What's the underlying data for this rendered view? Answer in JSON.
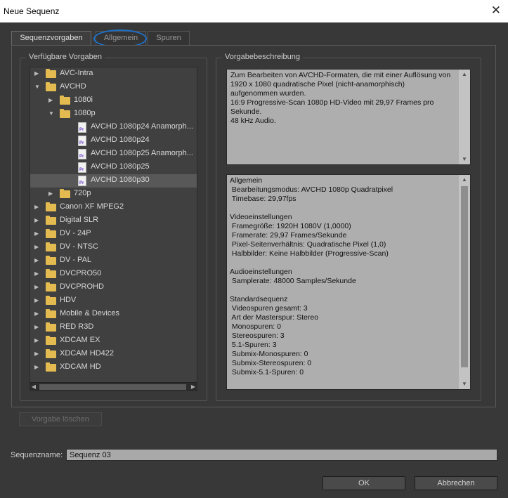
{
  "window": {
    "title": "Neue Sequenz",
    "close_glyph": "✕"
  },
  "tabs": [
    "Sequenzvorgaben",
    "Allgemein",
    "Spuren"
  ],
  "presets_group": {
    "label": "Verfügbare Vorgaben"
  },
  "tree": [
    {
      "label": "AVC-Intra",
      "type": "folder",
      "level": 0,
      "expanded": false
    },
    {
      "label": "AVCHD",
      "type": "folder",
      "level": 0,
      "expanded": true
    },
    {
      "label": "1080i",
      "type": "folder",
      "level": 1,
      "expanded": false
    },
    {
      "label": "1080p",
      "type": "folder",
      "level": 1,
      "expanded": true
    },
    {
      "label": "AVCHD 1080p24 Anamorph...",
      "type": "file",
      "level": 2
    },
    {
      "label": "AVCHD 1080p24",
      "type": "file",
      "level": 2
    },
    {
      "label": "AVCHD 1080p25 Anamorph...",
      "type": "file",
      "level": 2
    },
    {
      "label": "AVCHD 1080p25",
      "type": "file",
      "level": 2
    },
    {
      "label": "AVCHD 1080p30",
      "type": "file",
      "level": 2,
      "selected": true
    },
    {
      "label": "720p",
      "type": "folder",
      "level": 1,
      "expanded": false
    },
    {
      "label": "Canon XF MPEG2",
      "type": "folder",
      "level": 0,
      "expanded": false
    },
    {
      "label": "Digital SLR",
      "type": "folder",
      "level": 0,
      "expanded": false
    },
    {
      "label": "DV - 24P",
      "type": "folder",
      "level": 0,
      "expanded": false
    },
    {
      "label": "DV - NTSC",
      "type": "folder",
      "level": 0,
      "expanded": false
    },
    {
      "label": "DV - PAL",
      "type": "folder",
      "level": 0,
      "expanded": false
    },
    {
      "label": "DVCPRO50",
      "type": "folder",
      "level": 0,
      "expanded": false
    },
    {
      "label": "DVCPROHD",
      "type": "folder",
      "level": 0,
      "expanded": false
    },
    {
      "label": "HDV",
      "type": "folder",
      "level": 0,
      "expanded": false
    },
    {
      "label": "Mobile & Devices",
      "type": "folder",
      "level": 0,
      "expanded": false
    },
    {
      "label": "RED R3D",
      "type": "folder",
      "level": 0,
      "expanded": false
    },
    {
      "label": "XDCAM EX",
      "type": "folder",
      "level": 0,
      "expanded": false
    },
    {
      "label": "XDCAM HD422",
      "type": "folder",
      "level": 0,
      "expanded": false
    },
    {
      "label": "XDCAM HD",
      "type": "folder",
      "level": 0,
      "expanded": false
    }
  ],
  "description_group": {
    "label": "Vorgabebeschreibung"
  },
  "description_text": [
    "Zum Bearbeiten von AVCHD-Formaten, die mit einer Auflösung von",
    "1920 x 1080 quadratische Pixel (nicht-anamorphisch)",
    "aufgenommen wurden.",
    "16:9 Progressive-Scan 1080p HD-Video mit 29,97 Frames pro",
    "Sekunde.",
    "48 kHz Audio."
  ],
  "details_text": [
    "Allgemein",
    " Bearbeitungsmodus: AVCHD 1080p Quadratpixel",
    " Timebase: 29,97fps",
    "",
    "Videoeinstellungen",
    " Framegröße: 1920H 1080V (1,0000)",
    " Framerate: 29,97 Frames/Sekunde",
    " Pixel-Seitenverhältnis: Quadratische Pixel (1,0)",
    " Halbbilder: Keine Halbbilder (Progressive-Scan)",
    "",
    "Audioeinstellungen",
    " Samplerate: 48000 Samples/Sekunde",
    "",
    "Standardsequenz",
    " Videospuren gesamt: 3",
    " Art der Masterspur: Stereo",
    " Monospuren: 0",
    " Stereospuren: 3",
    " 5.1-Spuren: 3",
    " Submix-Monospuren: 0",
    " Submix-Stereospuren: 0",
    " Submix-5.1-Spuren: 0"
  ],
  "buttons": {
    "delete_preset": "Vorgabe löschen",
    "ok": "OK",
    "cancel": "Abbrechen"
  },
  "sequence_name": {
    "label": "Sequenzname:",
    "value": "Sequenz 03"
  },
  "colors": {
    "background": "#383838",
    "folder": "#e3bb51",
    "highlight_circle": "#1d71c9"
  }
}
